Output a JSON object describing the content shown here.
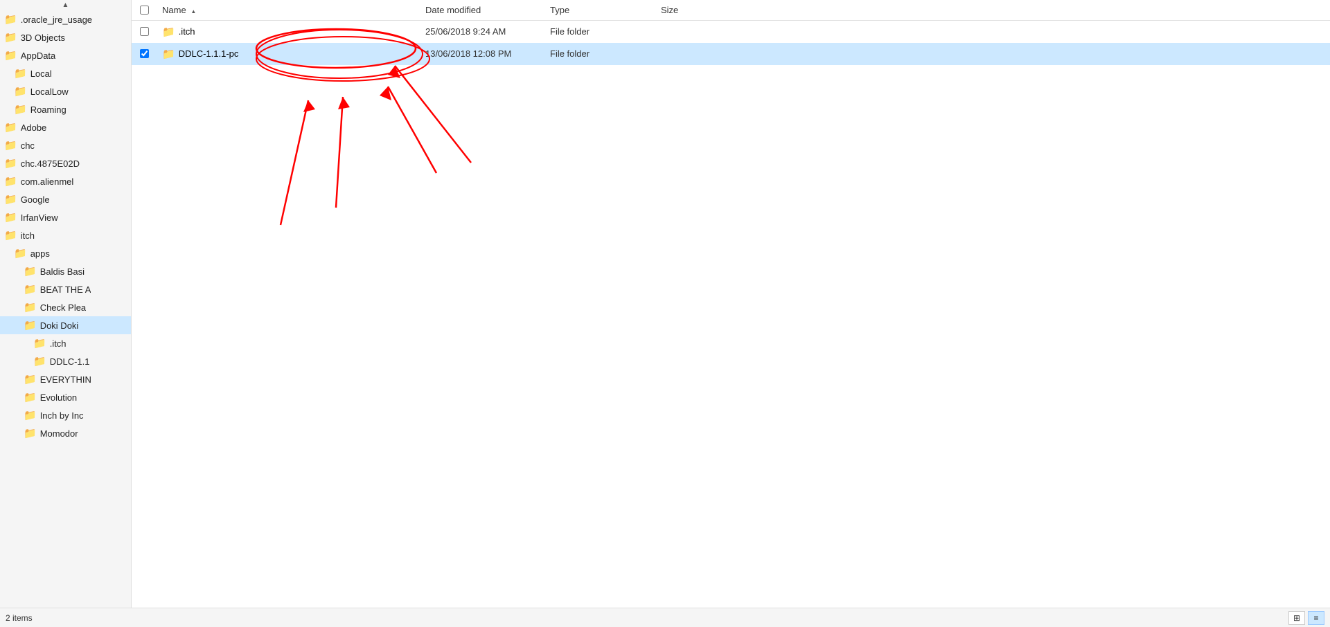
{
  "header": {
    "sort_arrow": "▲"
  },
  "columns": {
    "name": "Name",
    "date_modified": "Date modified",
    "type": "Type",
    "size": "Size"
  },
  "sidebar": {
    "items": [
      {
        "id": "oracle_jre_usage",
        "label": ".oracle_jre_usage",
        "indent": 0,
        "selected": false
      },
      {
        "id": "3d-objects",
        "label": "3D Objects",
        "indent": 0,
        "selected": false
      },
      {
        "id": "appdata",
        "label": "AppData",
        "indent": 0,
        "selected": false
      },
      {
        "id": "local",
        "label": "Local",
        "indent": 1,
        "selected": false
      },
      {
        "id": "localLow",
        "label": "LocalLow",
        "indent": 1,
        "selected": false
      },
      {
        "id": "roaming",
        "label": "Roaming",
        "indent": 1,
        "selected": false
      },
      {
        "id": "adobe",
        "label": "Adobe",
        "indent": 0,
        "selected": false
      },
      {
        "id": "chc",
        "label": "chc",
        "indent": 0,
        "selected": false
      },
      {
        "id": "chc4875",
        "label": "chc.4875E02D",
        "indent": 0,
        "selected": false
      },
      {
        "id": "com-alienmel",
        "label": "com.alienmel",
        "indent": 0,
        "selected": false
      },
      {
        "id": "google",
        "label": "Google",
        "indent": 0,
        "selected": false
      },
      {
        "id": "irfanview",
        "label": "IrfanView",
        "indent": 0,
        "selected": false
      },
      {
        "id": "itch",
        "label": "itch",
        "indent": 0,
        "selected": false
      },
      {
        "id": "apps",
        "label": "apps",
        "indent": 1,
        "selected": false
      },
      {
        "id": "baldis-basi",
        "label": "Baldis Basi",
        "indent": 2,
        "selected": false
      },
      {
        "id": "beat-the",
        "label": "BEAT THE A",
        "indent": 2,
        "selected": false
      },
      {
        "id": "check-plea",
        "label": "Check Plea",
        "indent": 2,
        "selected": false
      },
      {
        "id": "doki-doki",
        "label": "Doki Doki",
        "indent": 2,
        "selected": true
      },
      {
        "id": "dot-itch",
        "label": ".itch",
        "indent": 3,
        "selected": false
      },
      {
        "id": "ddlc-1-1",
        "label": "DDLC-1.1",
        "indent": 3,
        "selected": false
      },
      {
        "id": "everything",
        "label": "EVERYTHIN",
        "indent": 2,
        "selected": false
      },
      {
        "id": "evolution",
        "label": "Evolution",
        "indent": 2,
        "selected": false
      },
      {
        "id": "inch-by-inc",
        "label": "Inch by Inc",
        "indent": 2,
        "selected": false
      },
      {
        "id": "momodor",
        "label": "Momodor",
        "indent": 2,
        "selected": false
      }
    ]
  },
  "files": [
    {
      "id": "file-dot-itch",
      "name": ".itch",
      "date_modified": "25/06/2018 9:24 AM",
      "type": "File folder",
      "size": "",
      "selected": false
    },
    {
      "id": "file-ddlc",
      "name": "DDLC-1.1.1-pc",
      "date_modified": "13/06/2018 12:08 PM",
      "type": "File folder",
      "size": "",
      "selected": true
    }
  ],
  "status_bar": {
    "items_count": "2 items",
    "view_list_label": "≡",
    "view_detail_label": "⊞"
  }
}
